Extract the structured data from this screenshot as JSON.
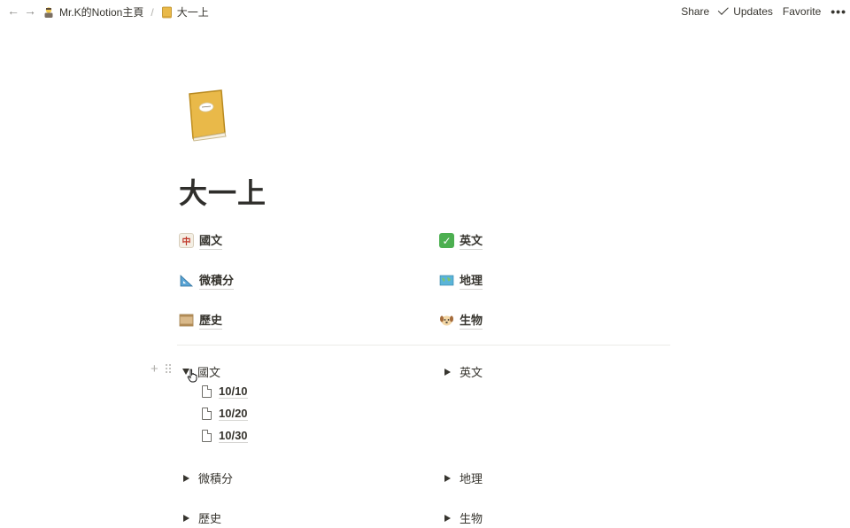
{
  "topbar": {
    "breadcrumb": [
      {
        "label": "Mr.K的Notion主頁",
        "icon": "person-emoji-icon"
      },
      {
        "label": "大一上",
        "icon": "book-emoji-icon"
      }
    ],
    "share_label": "Share",
    "updates_label": "Updates",
    "favorite_label": "Favorite",
    "more_label": "•••"
  },
  "page": {
    "title": "大一上",
    "icon": "book-emoji-icon"
  },
  "links": [
    {
      "label": "國文",
      "icon": "mahjong-tile-icon"
    },
    {
      "label": "英文",
      "icon": "check-mark-button-icon"
    },
    {
      "label": "微積分",
      "icon": "triangular-ruler-icon"
    },
    {
      "label": "地理",
      "icon": "world-map-icon"
    },
    {
      "label": "歷史",
      "icon": "scroll-icon"
    },
    {
      "label": "生物",
      "icon": "dog-face-icon"
    }
  ],
  "toggles": [
    {
      "label": "國文",
      "expanded": true,
      "children": [
        "10/10",
        "10/20",
        "10/30"
      ]
    },
    {
      "label": "英文",
      "expanded": false
    },
    {
      "label": "微積分",
      "expanded": false
    },
    {
      "label": "地理",
      "expanded": false
    },
    {
      "label": "歷史",
      "expanded": false
    },
    {
      "label": "生物",
      "expanded": false
    }
  ],
  "colors": {
    "text": "#37352f",
    "muted": "#8a8985",
    "book": "#e9b949"
  }
}
